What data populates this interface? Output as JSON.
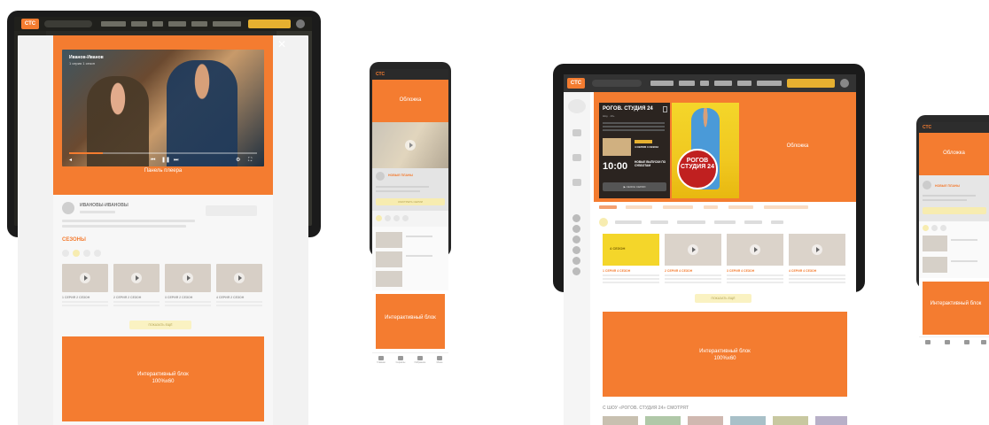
{
  "tablet1": {
    "logo": "СТС",
    "close_icon": "close-icon",
    "video": {
      "title": "Иванов-Иванов",
      "subtitle": "1 серия 1 сезон"
    },
    "player_label": "Панель плеера",
    "show": {
      "name": "ИВАНОВЫ-ИВАНОВЫ",
      "seasons_heading": "СЕЗОНЫ",
      "episodes": [
        "1 СЕРИЯ 2 СЕЗОН",
        "2 СЕРИЯ 2 СЕЗОН",
        "3 СЕРИЯ 2 СЕЗОН",
        "4 СЕРИЯ 2 СЕЗОН"
      ],
      "more_label": "ПОКАЗАТЬ ЕЩЁ"
    },
    "interactive_label": "Интерактивный блок",
    "interactive_size": "100%х60"
  },
  "phone1": {
    "logo": "СТС",
    "banner_label": "Обложка",
    "show_title": "НОВЫЕ ПЛАНЫ",
    "watch_label": "СМОТРЕТЬ СЕРИИ",
    "interactive_label": "Интерактивный блок",
    "nav": [
      "Главная",
      "Сериалы",
      "Избранное",
      "Меню"
    ]
  },
  "tablet3": {
    "logo": "СТС",
    "hero": {
      "title": "РОГОВ. СТУДИЯ 24",
      "subtitle": "Шоу · 16+",
      "new_label": "4 СЕРИЯ 4 СЕЗОН",
      "time": "10:00",
      "time_text": "НОВЫЕ ВЫПУСКИ ПО СУББОТАМ",
      "episodes_button": "▶ СЕЗОН СЕРИИ",
      "poster_title": "РОГОВ СТУДИЯ 24",
      "banner_label": "Обложка"
    },
    "first_thumb_label": "4 СЕЗОН",
    "episodes": [
      "1 СЕРИЯ 4 СЕЗОН",
      "2 СЕРИЯ 4 СЕЗОН",
      "3 СЕРИЯ 4 СЕЗОН",
      "4 СЕРИЯ 4 СЕЗОН"
    ],
    "more_label": "ПОКАЗАТЬ ЕЩЁ",
    "interactive_label": "Интерактивный блок",
    "interactive_size": "100%х60",
    "also_watch": "С ШОУ «РОГОВ. СТУДИЯ 24» СМОТРЯТ"
  },
  "phone2": {
    "logo": "СТС",
    "banner_label": "Обложка",
    "show_title": "НОВЫЕ ПЛАНЫ",
    "interactive_label": "Интерактивный блок"
  },
  "colors": {
    "accent": "#f47c30",
    "device": "#1b1b1b",
    "cta": "#e6b030"
  }
}
